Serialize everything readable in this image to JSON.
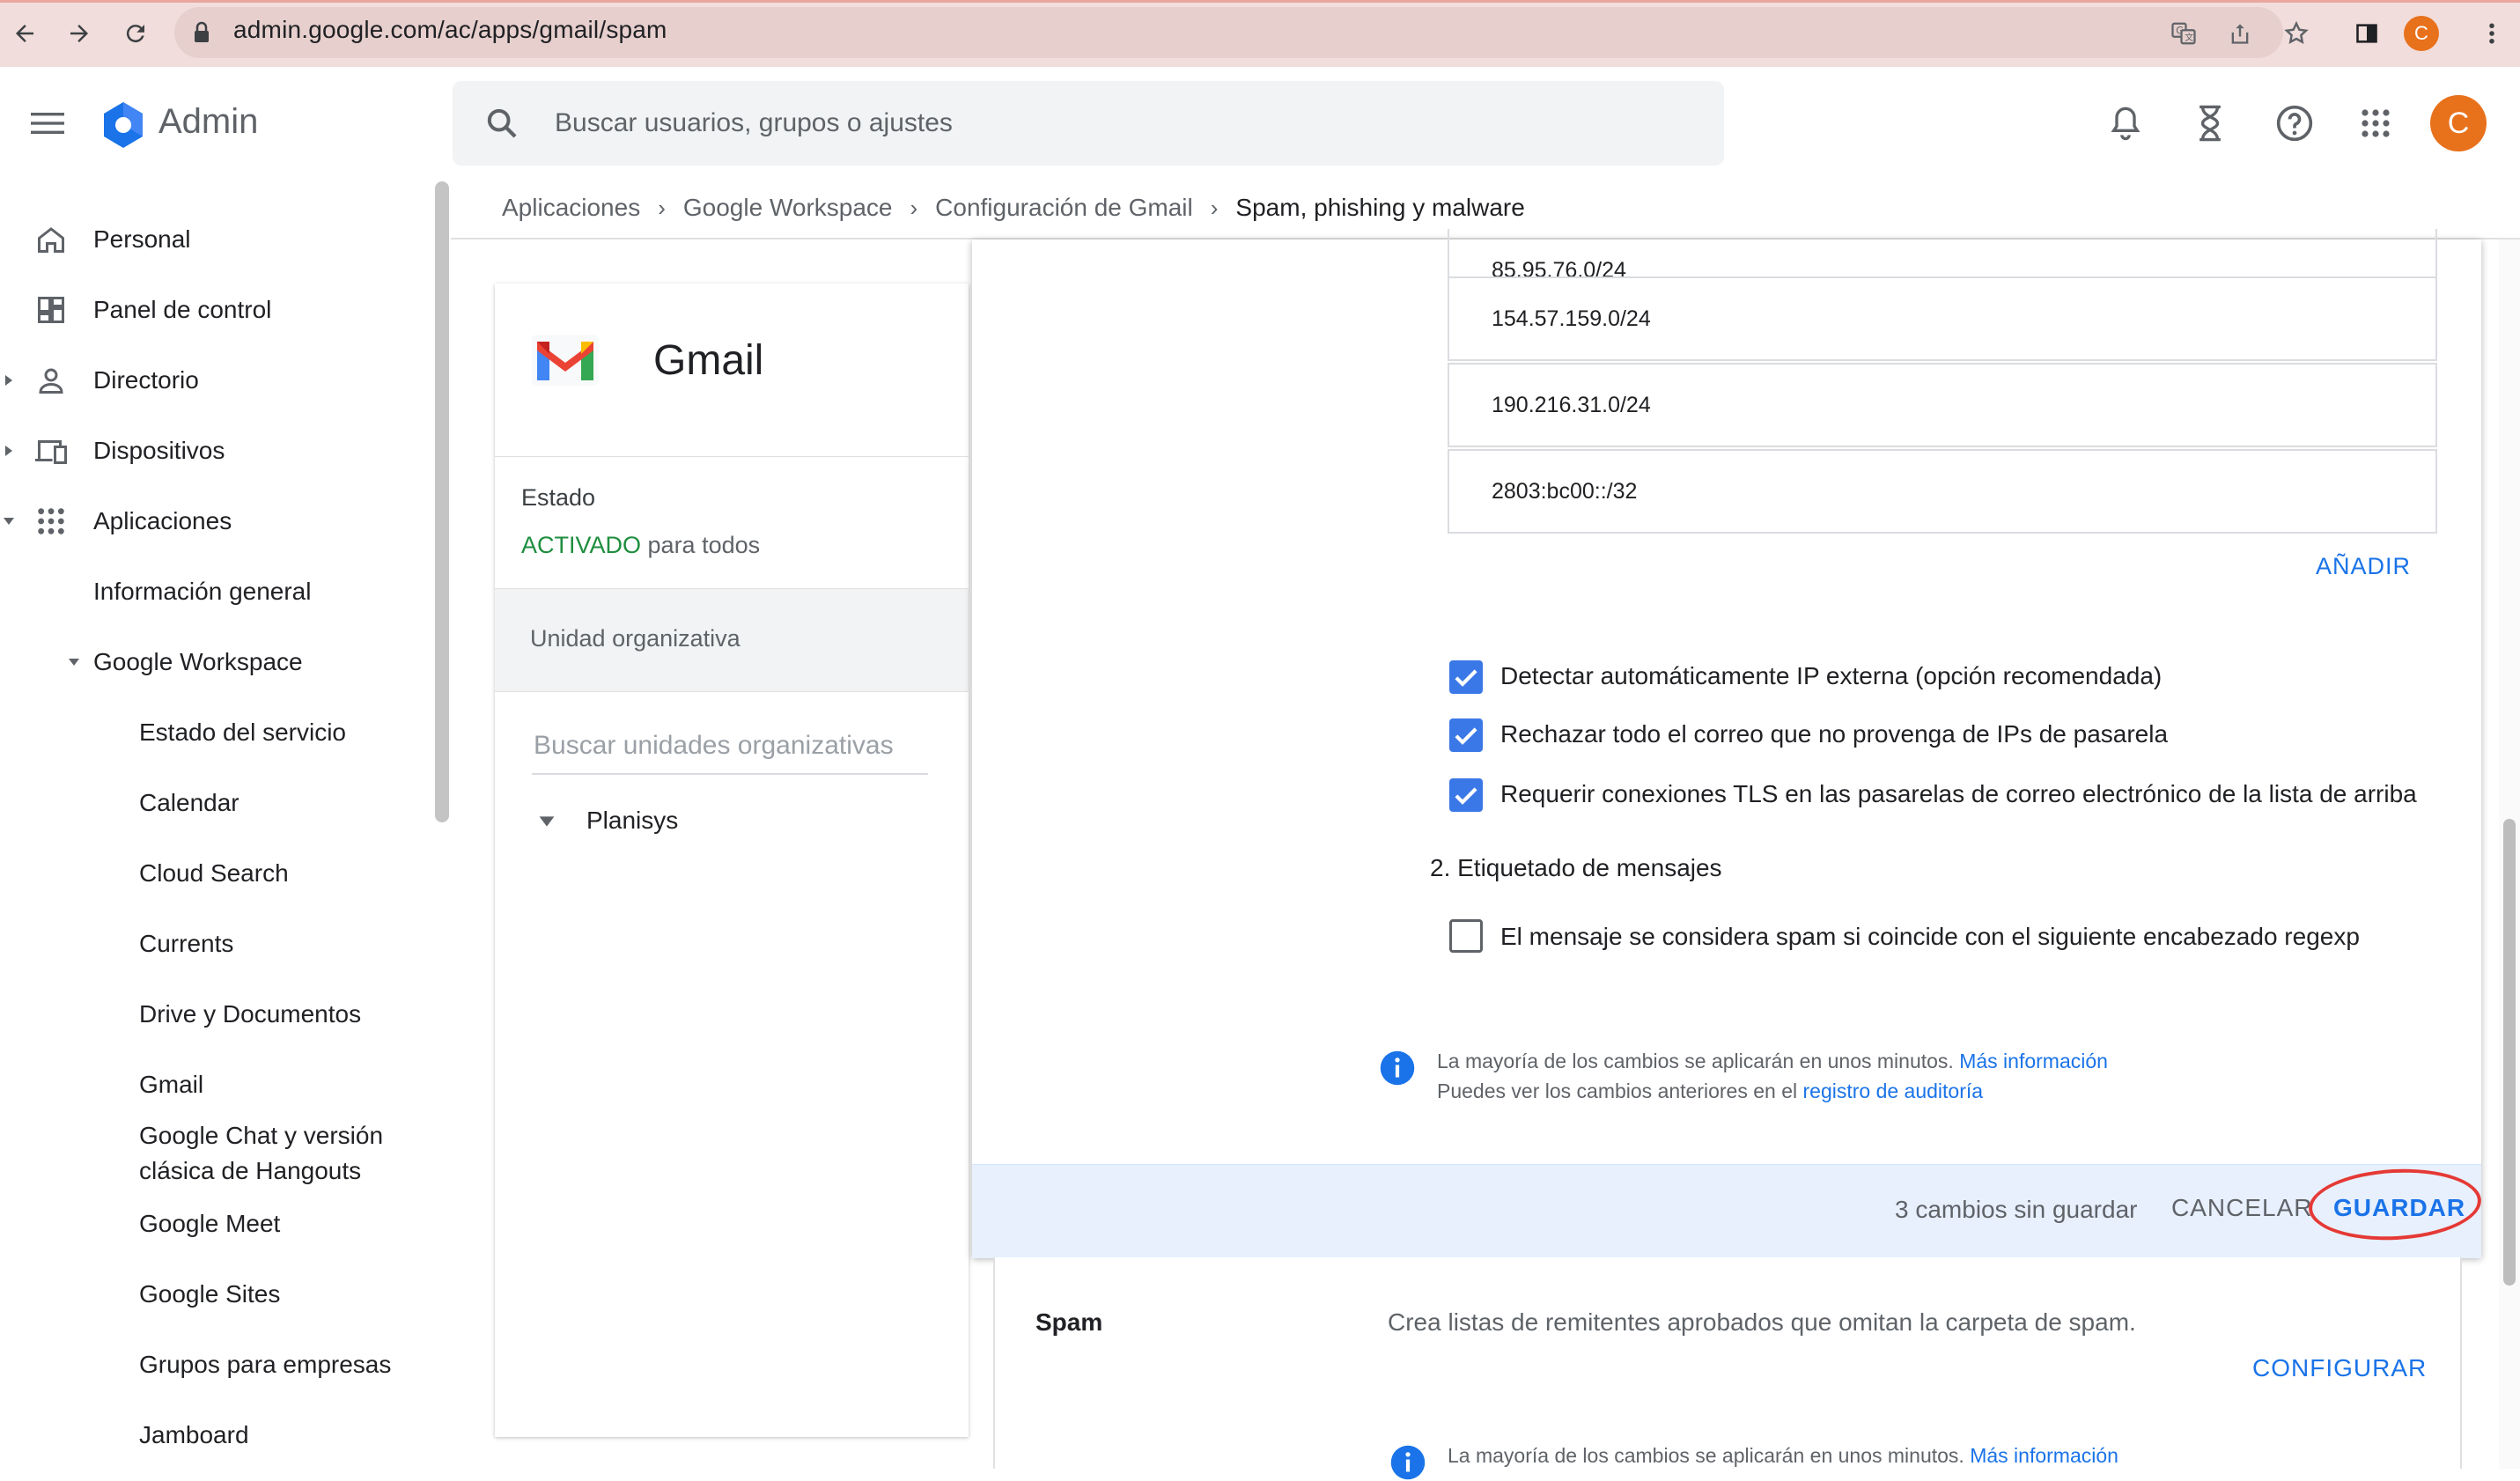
{
  "browser": {
    "url": "admin.google.com/ac/apps/gmail/spam",
    "profile_initial": "C"
  },
  "header": {
    "app_name": "Admin",
    "search_placeholder": "Buscar usuarios, grupos o ajustes",
    "avatar_initial": "C"
  },
  "sidebar": {
    "items": [
      {
        "label": "Personal",
        "icon": "home-icon"
      },
      {
        "label": "Panel de control",
        "icon": "dashboard-icon"
      },
      {
        "label": "Directorio",
        "icon": "person-icon"
      },
      {
        "label": "Dispositivos",
        "icon": "devices-icon"
      },
      {
        "label": "Aplicaciones",
        "icon": "apps-grid-icon"
      },
      {
        "label": "Información general"
      },
      {
        "label": "Google Workspace"
      },
      {
        "label": "Estado del servicio"
      },
      {
        "label": "Calendar"
      },
      {
        "label": "Cloud Search"
      },
      {
        "label": "Currents"
      },
      {
        "label": "Drive y Documentos"
      },
      {
        "label": "Gmail"
      },
      {
        "label": "Google Chat y versión",
        "label2": "clásica de Hangouts"
      },
      {
        "label": "Google Meet"
      },
      {
        "label": "Google Sites"
      },
      {
        "label": "Grupos para empresas"
      },
      {
        "label": "Jamboard"
      }
    ]
  },
  "breadcrumb": {
    "items": [
      "Aplicaciones",
      "Google Workspace",
      "Configuración de Gmail"
    ],
    "current": "Spam, phishing y malware"
  },
  "app_card": {
    "title": "Gmail",
    "status_label": "Estado",
    "status_on": "ACTIVADO",
    "status_rest": "para todos",
    "ou_label": "Unidad organizativa",
    "ou_search_placeholder": "Buscar unidades organizativas",
    "ou_root": "Planisys"
  },
  "panel": {
    "ip_partial": "85.95.76.0/24",
    "ip_list": [
      "154.57.159.0/24",
      "190.216.31.0/24",
      "2803:bc00::/32"
    ],
    "add_label": "AÑADIR",
    "checkboxes": [
      {
        "label": "Detectar automáticamente IP externa (opción recomendada)",
        "checked": true
      },
      {
        "label": "Rechazar todo el correo que no provenga de IPs de pasarela",
        "checked": true
      },
      {
        "label": "Requerir conexiones TLS en las pasarelas de correo electrónico de la lista de arriba",
        "checked": true
      }
    ],
    "section2_title": "2. Etiquetado de mensajes",
    "regexp_checkbox": {
      "label": "El mensaje se considera spam si coincide con el siguiente encabezado regexp",
      "checked": false
    },
    "info_line1": "La mayoría de los cambios se aplicarán en unos minutos.",
    "info_link1": "Más información",
    "info_line2": "Puedes ver los cambios anteriores en el",
    "info_link2": "registro de auditoría"
  },
  "savebar": {
    "unsaved_text": "3 cambios sin guardar",
    "cancel_label": "CANCELAR",
    "save_label": "GUARDAR"
  },
  "spam_section": {
    "title": "Spam",
    "description": "Crea listas de remitentes aprobados que omitan la carpeta de spam.",
    "configure_label": "CONFIGURAR",
    "info_line": "La mayoría de los cambios se aplicarán en unos minutos.",
    "info_link": "Más información"
  },
  "colors": {
    "accent": "#1a73e8",
    "checkbox_checked": "#3b78e7",
    "status_green": "#1e8e3e",
    "highlight_circle": "#e53935",
    "avatar": "#e8711c"
  }
}
